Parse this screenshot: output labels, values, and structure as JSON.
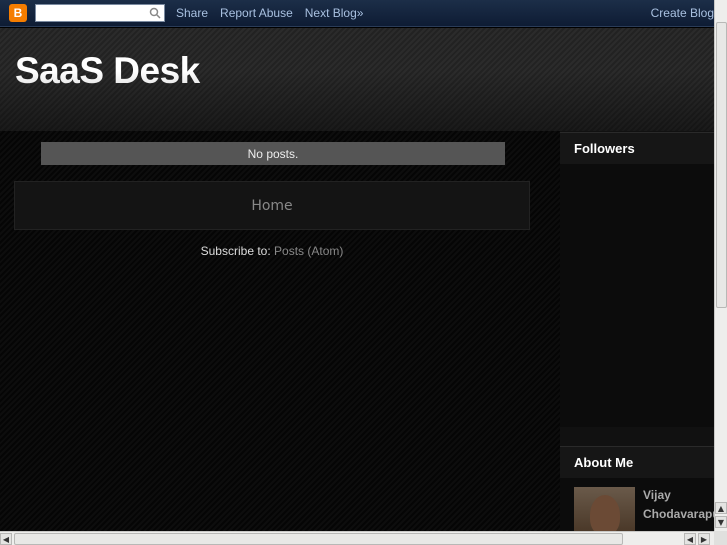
{
  "navbar": {
    "logo": "B",
    "search": {
      "value": "",
      "placeholder": ""
    },
    "links": [
      "Share",
      "Report Abuse",
      "Next Blog»"
    ],
    "create_blog": "Create Blog"
  },
  "header": {
    "title": "SaaS Desk"
  },
  "main": {
    "no_posts": "No posts.",
    "home_link": "Home",
    "subscribe_label": "Subscribe to:",
    "subscribe_link": "Posts (Atom)"
  },
  "sidebar": {
    "followers_title": "Followers",
    "about_title": "About Me",
    "author_name": "Vijay Chodavarapu"
  },
  "scrollbars": {
    "up_arrow": "▲",
    "down_arrow": "▼",
    "left_arrow": "◀",
    "right_arrow": "▶"
  }
}
